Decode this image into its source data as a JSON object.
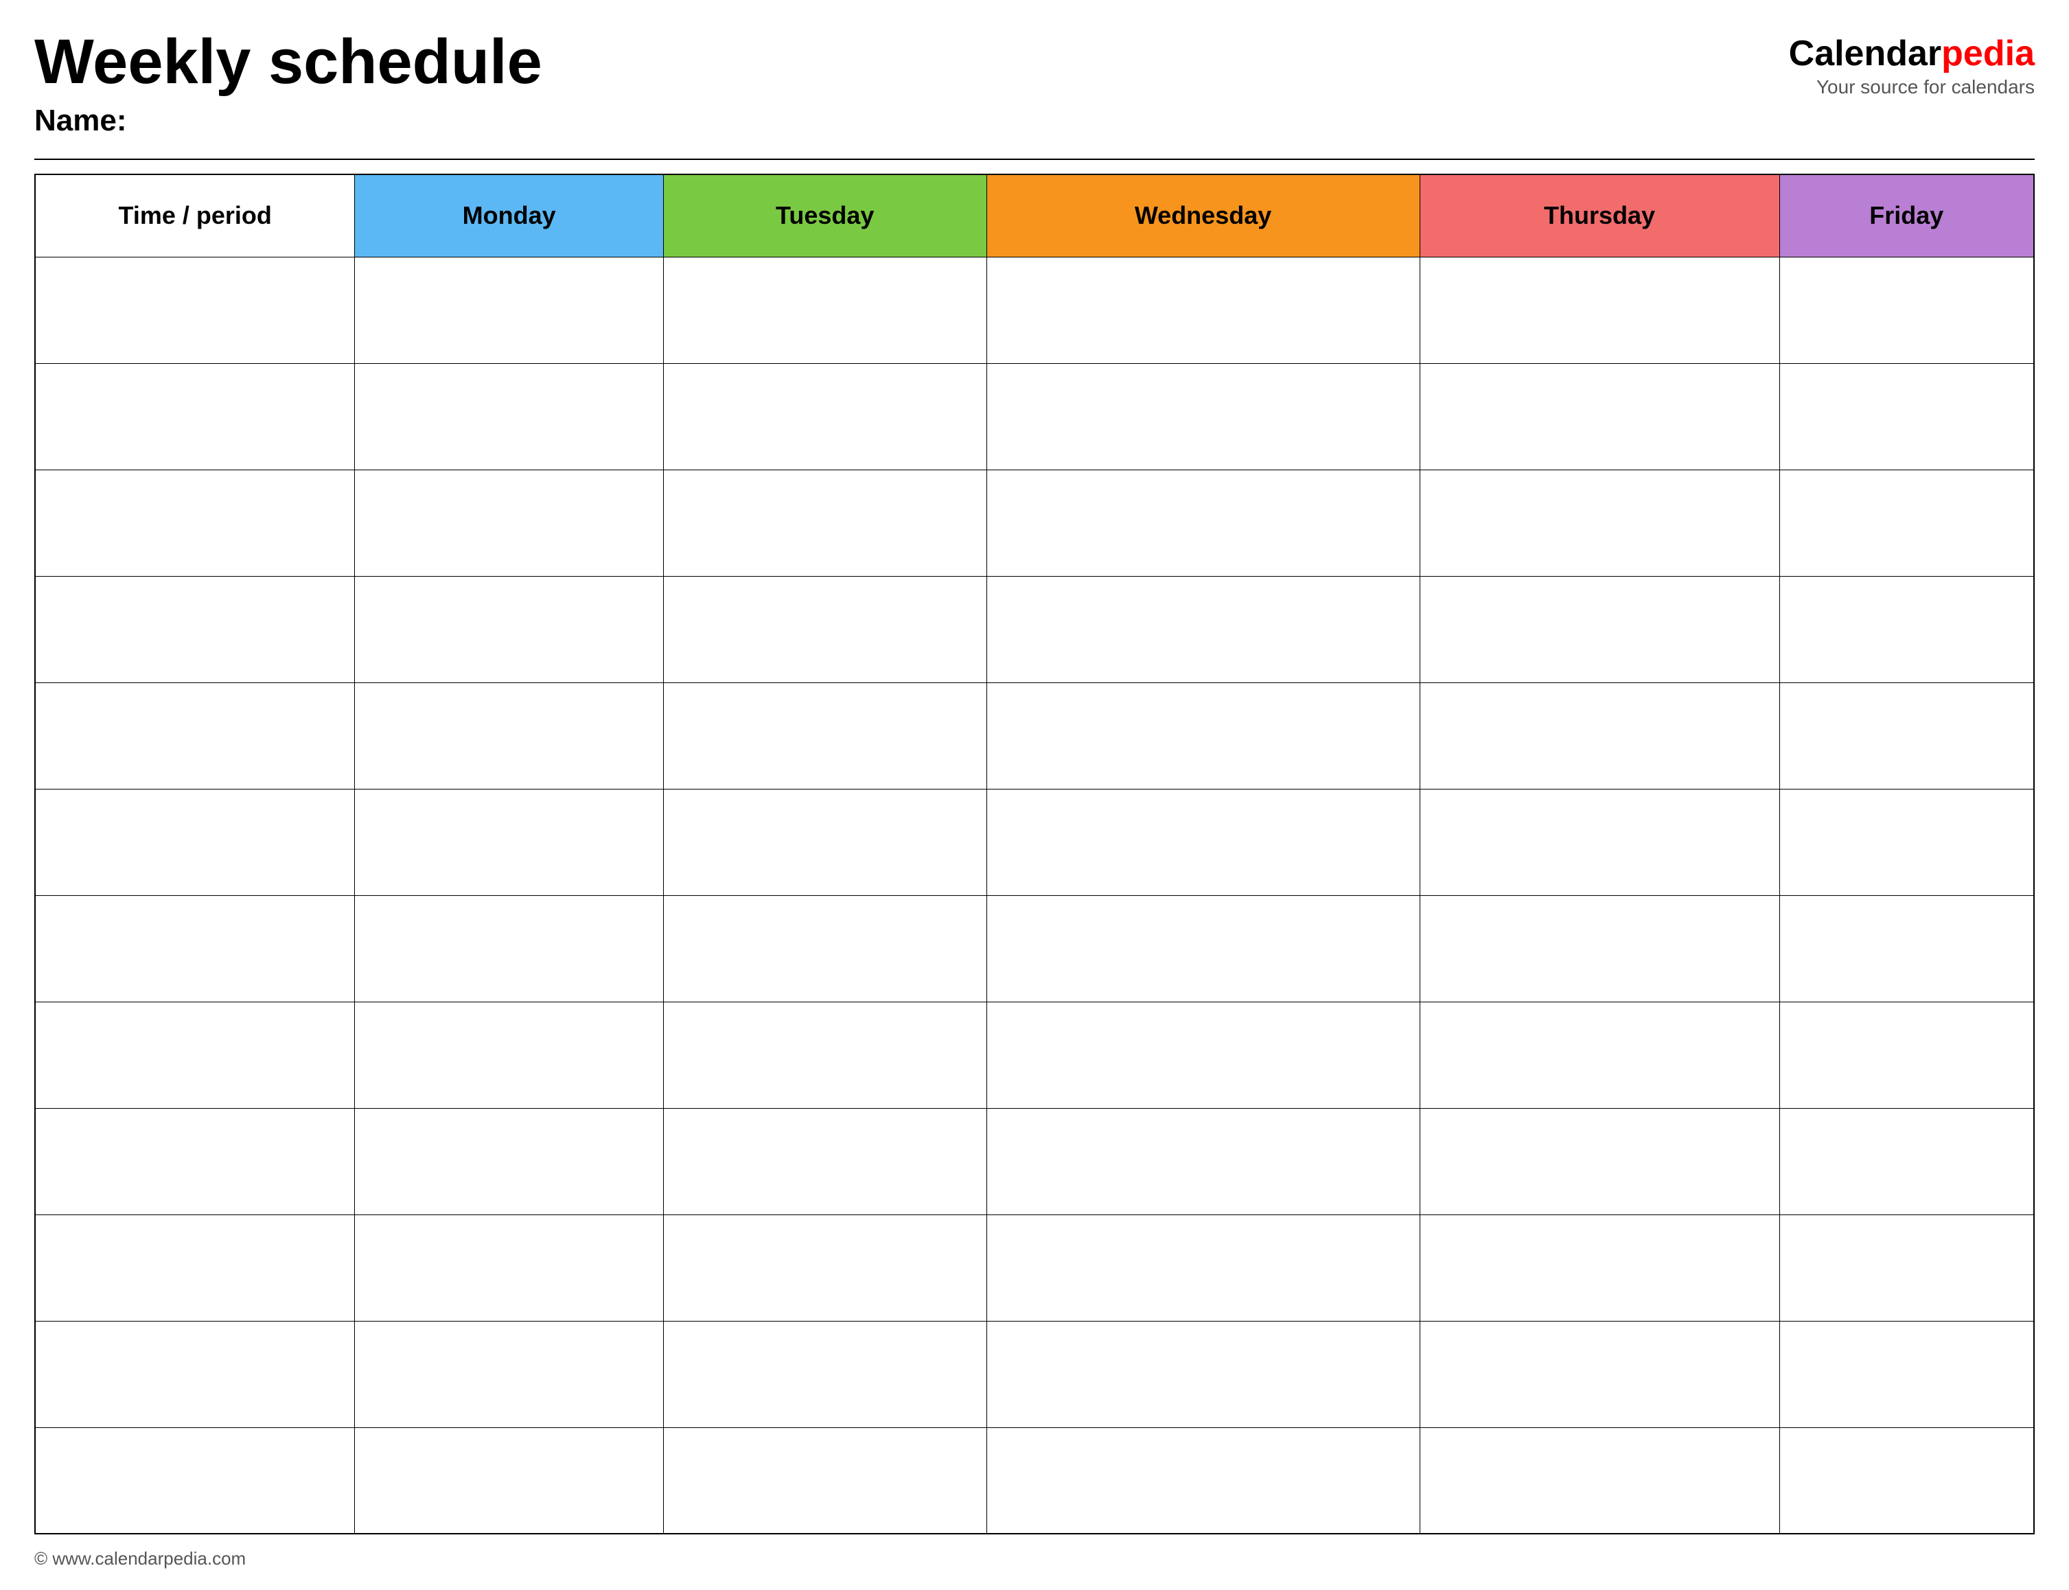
{
  "header": {
    "title": "Weekly schedule",
    "name_label": "Name:",
    "logo_calendar": "Calendar",
    "logo_pedia": "pedia",
    "logo_tagline": "Your source for calendars"
  },
  "table": {
    "headers": [
      {
        "key": "time",
        "label": "Time / period",
        "color": "#ffffff"
      },
      {
        "key": "monday",
        "label": "Monday",
        "color": "#5bb8f5"
      },
      {
        "key": "tuesday",
        "label": "Tuesday",
        "color": "#7ac943"
      },
      {
        "key": "wednesday",
        "label": "Wednesday",
        "color": "#f7941d"
      },
      {
        "key": "thursday",
        "label": "Thursday",
        "color": "#f26c6c"
      },
      {
        "key": "friday",
        "label": "Friday",
        "color": "#b97fd4"
      }
    ],
    "row_count": 12
  },
  "footer": {
    "url": "© www.calendarpedia.com"
  }
}
